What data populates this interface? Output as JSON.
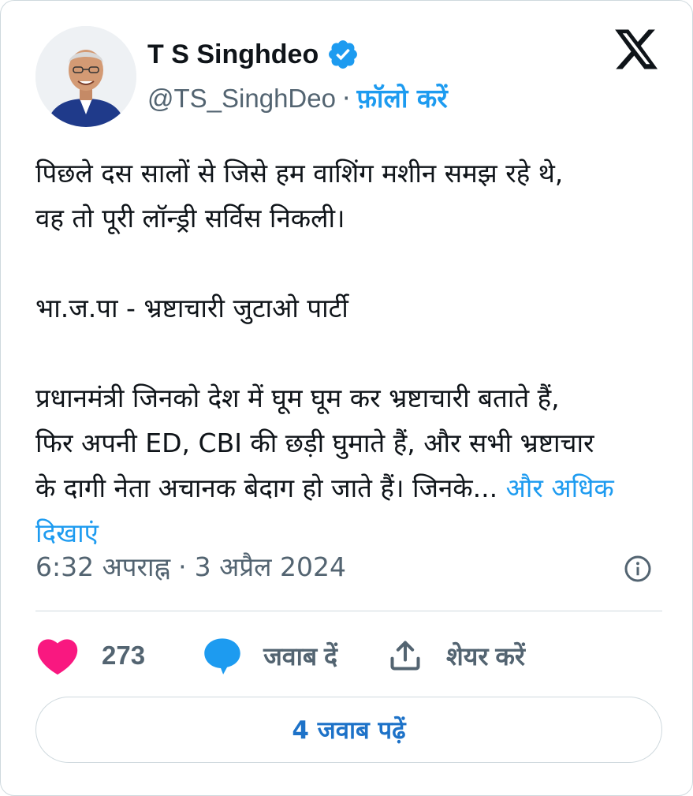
{
  "author": {
    "name": "T S Singhdeo",
    "handle": "@TS_SinghDeo",
    "separator": "·",
    "follow_label": "फ़ॉलो करें",
    "verified_icon": "verified-badge-icon",
    "avatar": "profile-photo"
  },
  "brand": {
    "logo": "x-logo-icon"
  },
  "tweet": {
    "paragraphs": [
      {
        "line1": "पिछले दस सालों से जिसे हम वाशिंग मशीन समझ रहे थे,",
        "line2": "वह तो पूरी लॉन्ड्री सर्विस निकली।"
      },
      {
        "line1": "भा.ज.पा - भ्रष्टाचारी जुटाओ पार्टी"
      }
    ],
    "last_paragraph": {
      "line1": "प्रधानमंत्री जिनको देश में घूम घूम कर भ्रष्टाचारी बताते हैं,",
      "line2": "फिर अपनी ED, CBI की छड़ी घुमाते हैं, और सभी भ्रष्टाचार",
      "line3": "के दागी नेता अचानक बेदाग हो जाते हैं। जिनके...",
      "show_more": "और अधिक दिखाएं"
    }
  },
  "meta": {
    "time": "6:32 अपराह्न",
    "separator": "·",
    "date": "3 अप्रैल 2024",
    "info_icon": "info-icon"
  },
  "actions": {
    "likes_count": "273",
    "reply_label": "जवाब दें",
    "share_label": "शेयर करें"
  },
  "read_replies_label": "4 जवाब पढ़ें",
  "colors": {
    "accent": "#1d9bf0",
    "like": "#f91880",
    "text": "#0f1419",
    "secondary": "#536471",
    "border": "#cfd9de"
  }
}
